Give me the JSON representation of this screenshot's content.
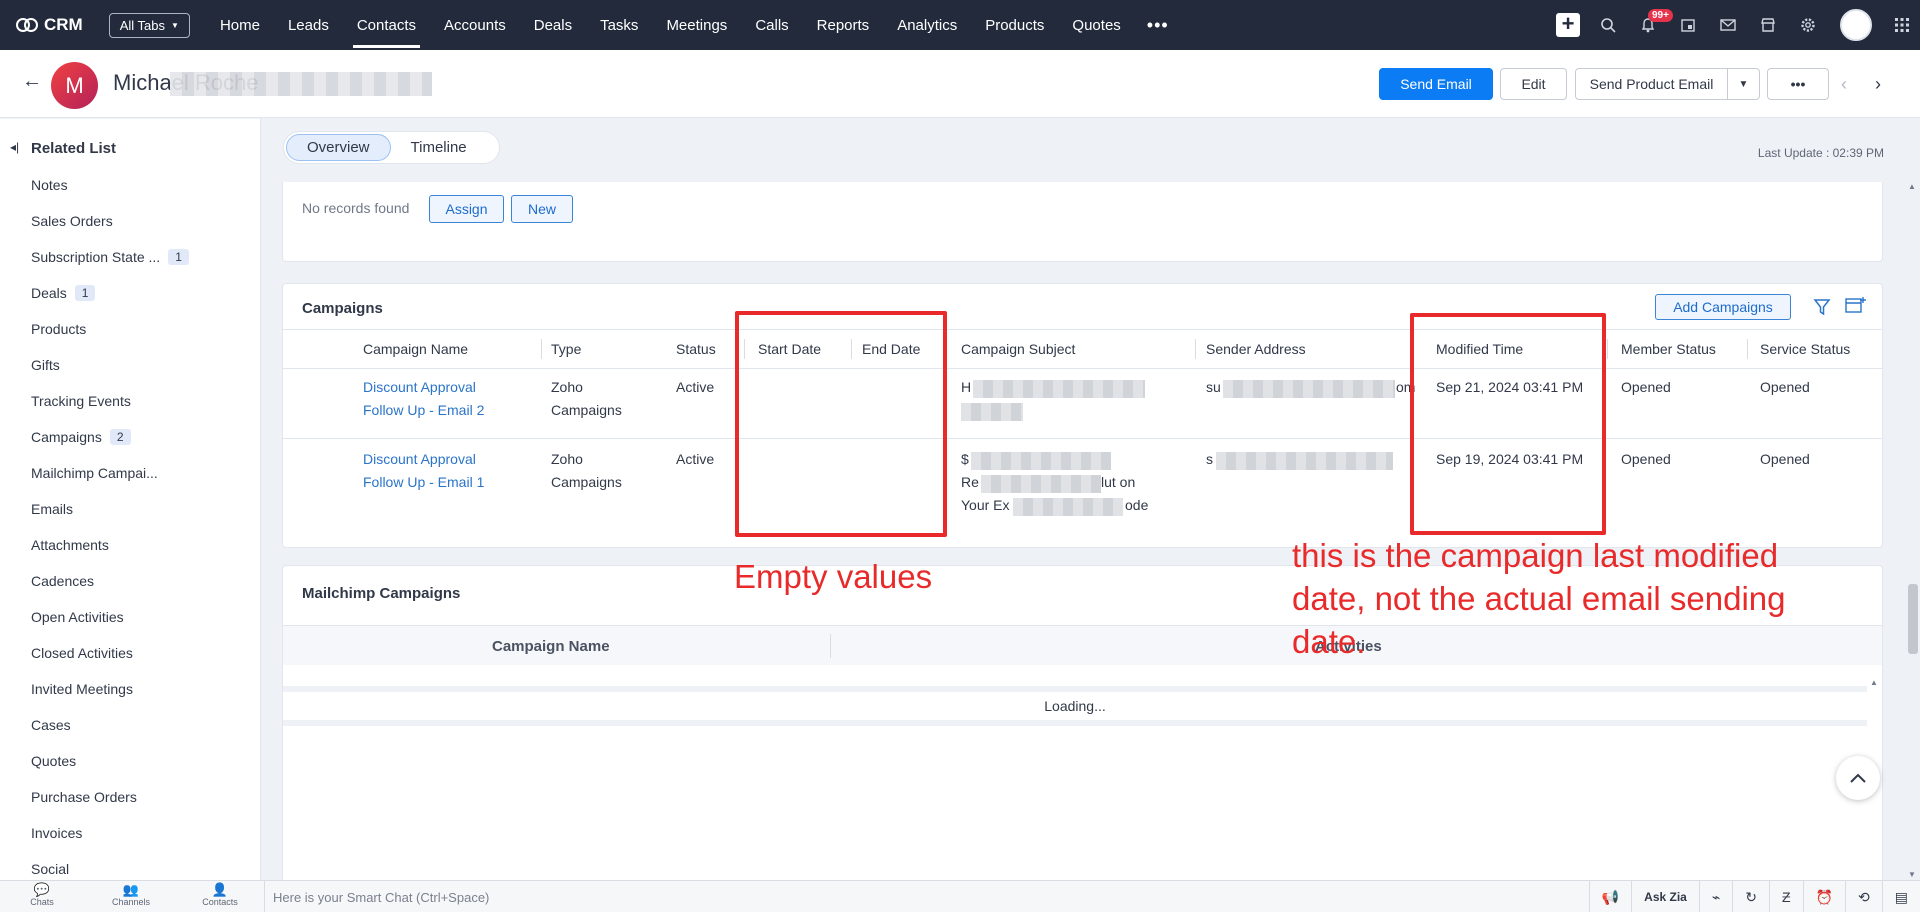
{
  "app": {
    "name": "CRM",
    "all_tabs": "All Tabs"
  },
  "nav": {
    "tabs": [
      "Home",
      "Leads",
      "Contacts",
      "Accounts",
      "Deals",
      "Tasks",
      "Meetings",
      "Calls",
      "Reports",
      "Analytics",
      "Products",
      "Quotes"
    ],
    "active_tab": "Contacts",
    "more": "•••",
    "notification_count": "99+"
  },
  "record": {
    "avatar_letter": "M",
    "name": "Michael Roche",
    "buttons": {
      "send_email": "Send Email",
      "edit": "Edit",
      "send_product_email": "Send Product Email",
      "more": "•••"
    }
  },
  "sidebar": {
    "title": "Related List",
    "items": [
      {
        "label": "Notes",
        "count": ""
      },
      {
        "label": "Sales Orders",
        "count": ""
      },
      {
        "label": "Subscription State ...",
        "count": "1"
      },
      {
        "label": "Deals",
        "count": "1"
      },
      {
        "label": "Products",
        "count": ""
      },
      {
        "label": "Gifts",
        "count": ""
      },
      {
        "label": "Tracking Events",
        "count": ""
      },
      {
        "label": "Campaigns",
        "count": "2"
      },
      {
        "label": "Mailchimp Campai...",
        "count": ""
      },
      {
        "label": "Emails",
        "count": ""
      },
      {
        "label": "Attachments",
        "count": ""
      },
      {
        "label": "Cadences",
        "count": ""
      },
      {
        "label": "Open Activities",
        "count": ""
      },
      {
        "label": "Closed Activities",
        "count": ""
      },
      {
        "label": "Invited Meetings",
        "count": ""
      },
      {
        "label": "Cases",
        "count": ""
      },
      {
        "label": "Quotes",
        "count": ""
      },
      {
        "label": "Purchase Orders",
        "count": ""
      },
      {
        "label": "Invoices",
        "count": ""
      },
      {
        "label": "Social",
        "count": ""
      }
    ]
  },
  "view_tabs": {
    "overview": "Overview",
    "timeline": "Timeline",
    "last_update": "Last Update : 02:39 PM"
  },
  "prev_section": {
    "no_records": "No records found",
    "assign": "Assign",
    "new": "New"
  },
  "campaigns": {
    "title": "Campaigns",
    "add_button": "Add Campaigns",
    "columns": [
      "Campaign Name",
      "Type",
      "Status",
      "Start Date",
      "End Date",
      "Campaign Subject",
      "Sender Address",
      "Modified Time",
      "Member Status",
      "Service Status"
    ],
    "rows": [
      {
        "name_line1": "Discount Approval",
        "name_line2": "Follow Up - Email 2",
        "type_line1": "Zoho",
        "type_line2": "Campaigns",
        "status": "Active",
        "start_date": "",
        "end_date": "",
        "subject_line1": "H",
        "subject_line2": "",
        "subject_line3": "",
        "sender": "su",
        "sender_end": "om",
        "modified": "Sep 21, 2024 03:41 PM",
        "member_status": "Opened",
        "service_status": "Opened"
      },
      {
        "name_line1": "Discount Approval",
        "name_line2": "Follow Up - Email 1",
        "type_line1": "Zoho",
        "type_line2": "Campaigns",
        "status": "Active",
        "start_date": "",
        "end_date": "",
        "subject_line1": "$",
        "subject_line2": "Re",
        "subject_line2_end": "lut on",
        "subject_line3": "Your Ex",
        "subject_line3_end": "ode",
        "sender": "s",
        "sender_end": "",
        "modified": "Sep 19, 2024 03:41 PM",
        "member_status": "Opened",
        "service_status": "Opened"
      }
    ]
  },
  "mailchimp": {
    "title": "Mailchimp Campaigns",
    "col_name": "Campaign Name",
    "col_activities": "Activities",
    "loading": "Loading..."
  },
  "annotations": {
    "empty_values": "Empty values",
    "modified_note": "this is the campaign last modified date, not the actual email sending date.",
    "color": "#e82a2a"
  },
  "bottom": {
    "chats": "Chats",
    "channels": "Channels",
    "contacts": "Contacts",
    "smart_chat": "Here is your Smart Chat (Ctrl+Space)",
    "ask_zia": "Ask Zia"
  }
}
